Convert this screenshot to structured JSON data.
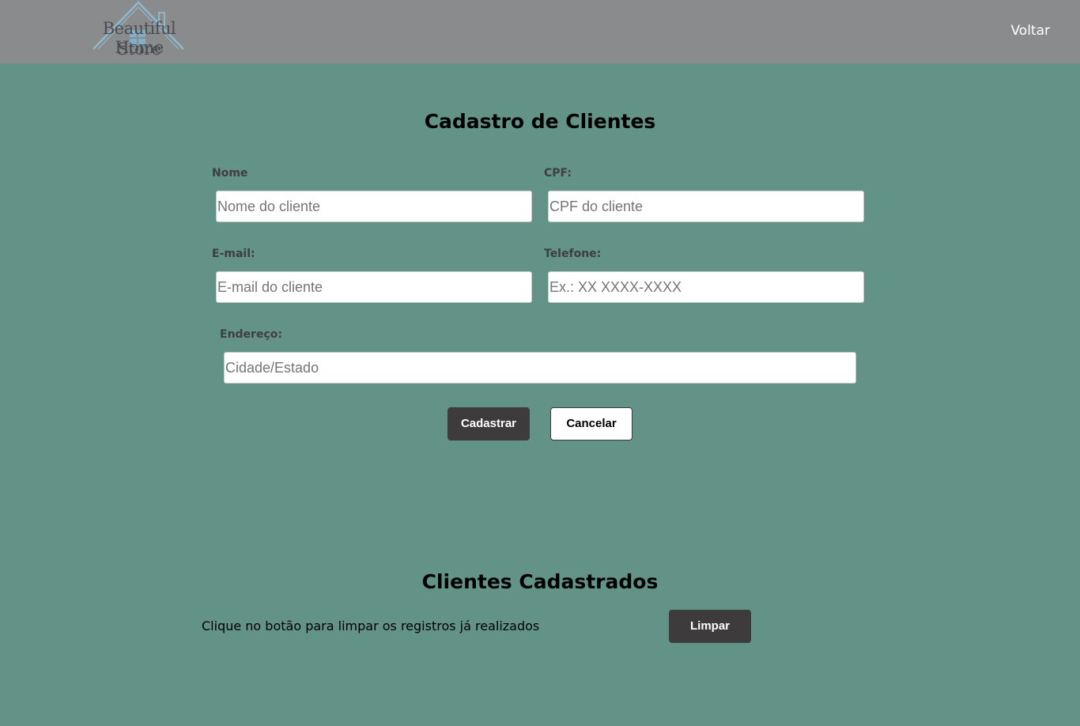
{
  "header": {
    "logo_line1": "Beautiful Home",
    "logo_line2": "Store",
    "back_link": "Voltar"
  },
  "form": {
    "title": "Cadastro de Clientes",
    "nome": {
      "label": "Nome",
      "placeholder": "Nome do cliente",
      "value": ""
    },
    "cpf": {
      "label": "CPF:",
      "placeholder": "CPF do cliente",
      "value": ""
    },
    "email": {
      "label": "E-mail:",
      "placeholder": "E-mail do cliente",
      "value": ""
    },
    "telefone": {
      "label": "Telefone:",
      "placeholder": "Ex.: XX XXXX-XXXX",
      "value": ""
    },
    "endereco": {
      "label": "Endereço:",
      "placeholder": "Cidade/Estado",
      "value": ""
    },
    "submit_label": "Cadastrar",
    "cancel_label": "Cancelar"
  },
  "clients": {
    "title": "Clientes Cadastrados",
    "clear_text": "Clique no botão para limpar os registros já realizados",
    "clear_label": "Limpar"
  },
  "colors": {
    "header_bg": "#8a8b8d",
    "page_bg": "#639287",
    "button_dark": "#3d3b3c",
    "logo_accent": "#8fb8cc"
  },
  "icons": {
    "logo": "house-icon"
  }
}
